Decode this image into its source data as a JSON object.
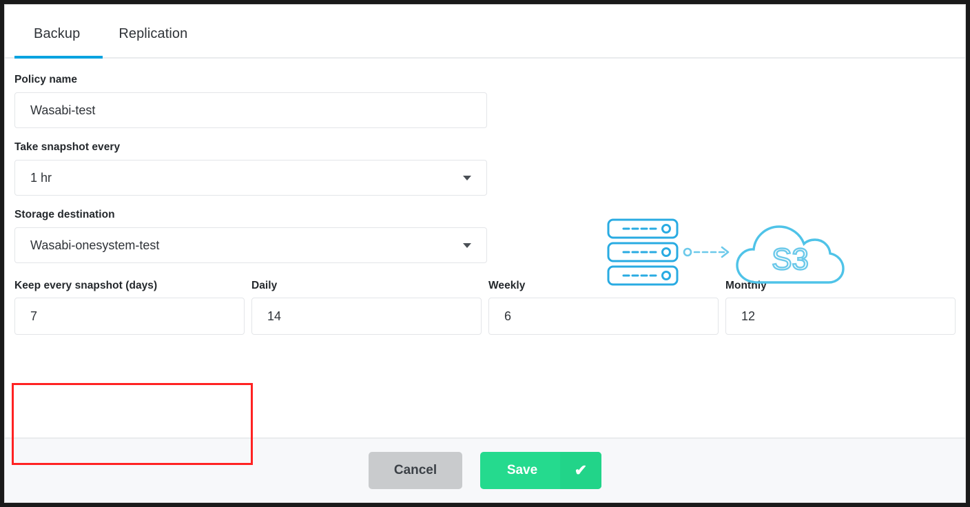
{
  "tabs": [
    {
      "label": "Backup",
      "active": true
    },
    {
      "label": "Replication",
      "active": false
    }
  ],
  "form": {
    "policy_name": {
      "label": "Policy name",
      "value": "Wasabi-test"
    },
    "snapshot_interval": {
      "label": "Take snapshot every",
      "value": "1 hr"
    },
    "storage_destination": {
      "label": "Storage destination",
      "value": "Wasabi-onesystem-test"
    },
    "retention": [
      {
        "label": "Keep every snapshot (days)",
        "value": "7",
        "highlighted": true
      },
      {
        "label": "Daily",
        "value": "14",
        "highlighted": false
      },
      {
        "label": "Weekly",
        "value": "6",
        "highlighted": false
      },
      {
        "label": "Monthly",
        "value": "12",
        "highlighted": false
      }
    ]
  },
  "illustration": {
    "cloud_label": "S3",
    "server_count": 3,
    "line_color": "#4fc3e8",
    "accent_color": "#29abe2"
  },
  "footer": {
    "cancel_label": "Cancel",
    "save_label": "Save",
    "check_glyph": "✔"
  },
  "colors": {
    "tab_active_underline": "#00a3e0",
    "save_green": "#25da8e",
    "cancel_gray": "#c9cbcd",
    "highlight_red": "#ff2222",
    "input_border": "#e3e5e8",
    "text_primary": "#2f3338"
  }
}
